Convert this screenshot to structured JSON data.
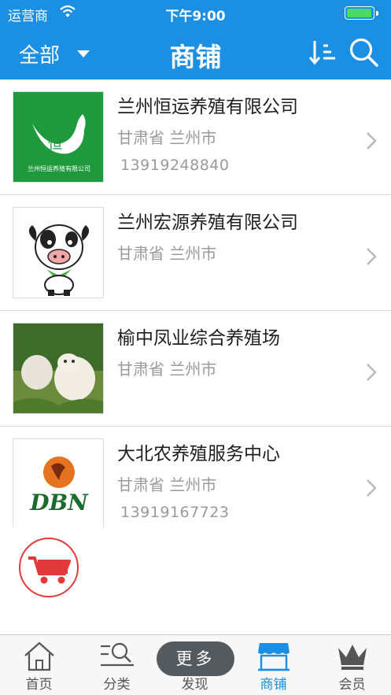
{
  "status_bar": {
    "carrier": "运营商",
    "time": "下午9:00",
    "battery_level": 0.9
  },
  "nav": {
    "filter_label": "全部",
    "title": "商铺",
    "icons": [
      "sort-icon",
      "search-icon"
    ]
  },
  "shops": [
    {
      "name": "兰州恒运养殖有限公司",
      "region": "甘肃省 兰州市",
      "phone": "13919248840",
      "logo_text": "兰州恒运养殖有限公司",
      "logo_char": "恒",
      "logo_color": "#1e9a3c"
    },
    {
      "name": "兰州宏源养殖有限公司",
      "region": "甘肃省 兰州市",
      "phone": ""
    },
    {
      "name": "榆中凤业综合养殖场",
      "region": "甘肃省 兰州市",
      "phone": ""
    },
    {
      "name": "大北农养殖服务中心",
      "region": "甘肃省 兰州市",
      "phone": "13919167723",
      "logo_text": "DBN"
    }
  ],
  "tabs": [
    {
      "label": "首页",
      "icon": "home-icon"
    },
    {
      "label": "分类",
      "icon": "category-search-icon"
    },
    {
      "label": "发现",
      "icon": "more-pill",
      "pill_text": "更多"
    },
    {
      "label": "商铺",
      "icon": "shop-icon",
      "active": true
    },
    {
      "label": "会员",
      "icon": "crown-icon"
    }
  ],
  "colors": {
    "accent": "#1a8fe3",
    "cart": "#e23a3a"
  }
}
